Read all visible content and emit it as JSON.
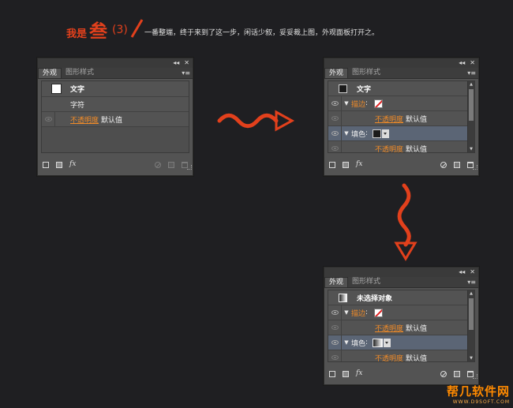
{
  "header": {
    "prefix": "我是",
    "step_char": "叁",
    "step_num": "(3)",
    "description": "一番整端，终于来到了这一步，闲话少叙，妥妥裁上图，外观面板打开之。"
  },
  "panel1": {
    "tabs": [
      "外观",
      "图形样式"
    ],
    "rows": {
      "header_label": "文字",
      "char_label": "字符",
      "opacity_label": "不透明度",
      "opacity_value": "默认值"
    }
  },
  "panel2": {
    "tabs": [
      "外观",
      "图形样式"
    ],
    "rows": {
      "header_label": "文字",
      "stroke_label": "描边",
      "opacity_label": "不透明度",
      "opacity_value": "默认值",
      "fill_label": "填色",
      "opacity2_label": "不透明度",
      "opacity2_value": "默认值"
    }
  },
  "panel3": {
    "tabs": [
      "外观",
      "图形样式"
    ],
    "rows": {
      "header_label": "未选择对象",
      "stroke_label": "描边",
      "opacity_label": "不透明度",
      "opacity_value": "默认值",
      "fill_label": "填色",
      "opacity2_label": "不透明度",
      "opacity2_value": "默认值"
    }
  },
  "panel_controls": {
    "collapse": "◂◂",
    "close": "✕",
    "menu": "▾≡",
    "fx": "fx"
  },
  "watermark": {
    "name": "帮几软件网",
    "url": "WWW.D9SOFT.COM"
  },
  "colors": {
    "accent": "#e2401c",
    "orange_label": "#f08b28",
    "panel_bg": "#535353",
    "highlight_row": "#5b6575",
    "page_bg": "#1f1f22"
  }
}
